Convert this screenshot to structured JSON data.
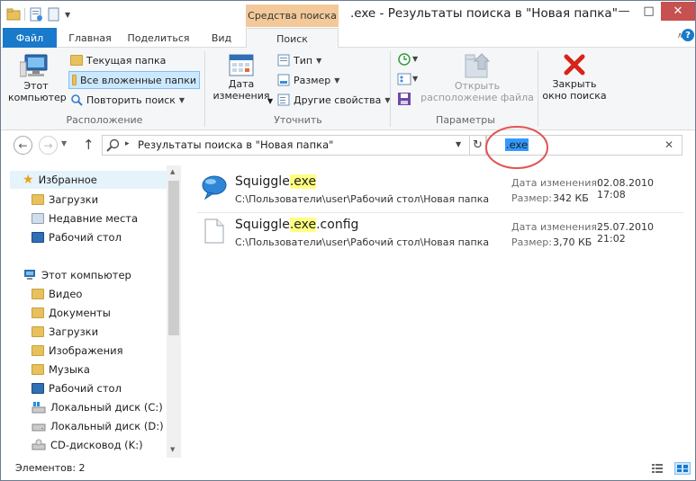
{
  "window": {
    "title": ".exe - Результаты поиска в \"Новая папка\"",
    "context_tab": "Средства поиска"
  },
  "tabs": [
    "Файл",
    "Главная",
    "Поделиться",
    "Вид",
    "Поиск"
  ],
  "ribbon": {
    "location": {
      "this_pc": "Этот\nкомпьютер",
      "current_folder": "Текущая папка",
      "all_subfolders": "Все вложенные папки",
      "search_again": "Повторить поиск",
      "label": "Расположение"
    },
    "refine": {
      "date_modified": "Дата\nизменения",
      "type": "Тип",
      "size": "Размер",
      "other": "Другие свойства",
      "label": "Уточнить"
    },
    "options": {
      "open_location": "Открыть\nрасположение файла",
      "label": "Параметры"
    },
    "close": {
      "label": "Закрыть\nокно поиска"
    }
  },
  "address": {
    "text": "Результаты поиска в \"Новая папка\""
  },
  "search": {
    "value": ".exe"
  },
  "nav": {
    "favorites": "Избранное",
    "fav_items": [
      "Загрузки",
      "Недавние места",
      "Рабочий стол"
    ],
    "this_pc": "Этот компьютер",
    "pc_items": [
      "Видео",
      "Документы",
      "Загрузки",
      "Изображения",
      "Музыка",
      "Рабочий стол",
      "Локальный диск (C:)",
      "Локальный диск (D:)",
      "CD-дисковод (K:)"
    ]
  },
  "results": [
    {
      "name_pre": "Squiggle",
      "name_hl": ".exe",
      "name_post": "",
      "path": "C:\\Пользователи\\user\\Рабочий стол\\Новая папка",
      "date_label": "Дата изменения:",
      "date": "02.08.2010 17:08",
      "size_label": "Размер:",
      "size": "342 КБ"
    },
    {
      "name_pre": "Squiggle",
      "name_hl": ".exe",
      "name_post": ".config",
      "path": "C:\\Пользователи\\user\\Рабочий стол\\Новая папка",
      "date_label": "Дата изменения:",
      "date": "25.07.2010 21:02",
      "size_label": "Размер:",
      "size": "3,70 КБ"
    }
  ],
  "status": {
    "text": "Элементов: 2"
  },
  "colors": {
    "accent": "#1979ca",
    "context": "#f3c99a",
    "highlight": "#ffff80",
    "annotation": "#e05555",
    "close": "#c75050"
  }
}
